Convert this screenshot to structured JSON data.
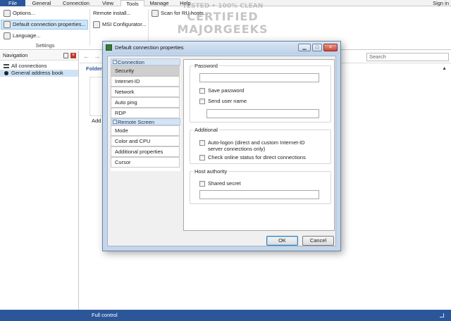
{
  "tabs": [
    "File",
    "General",
    "Connection",
    "View",
    "Tools",
    "Manage",
    "Help"
  ],
  "signin": "Sign in",
  "ribbon": {
    "options": "Options...",
    "default_conn": "Default connection properties...",
    "language": "Language...",
    "remote_install": "Remote install...",
    "msi_config": "MSI Configurator...",
    "scan": "Scan for RU hosts...",
    "group_settings": "Settings"
  },
  "watermark": {
    "line1": "TESTED • 100% CLEAN",
    "line2": "CERTIFIED",
    "line3": "MAJORGEEKS"
  },
  "navigation": {
    "title": "Navigation",
    "items": [
      "All connections",
      "General address book"
    ]
  },
  "main": {
    "search_placeholder": "Search",
    "folder_label": "Folder",
    "add_label": "Add"
  },
  "dialog": {
    "title": "Default connection properties",
    "categories": {
      "connection_header": "Connection",
      "connection_items": [
        "Security",
        "Internet-ID",
        "Network",
        "Auto ping",
        "RDP"
      ],
      "remote_header": "Remote Screen",
      "remote_items": [
        "Mode",
        "Color and CPU",
        "Additional properties",
        "Cursor"
      ]
    },
    "password_group": "Password",
    "save_password": "Save password",
    "send_user_name": "Send user name",
    "additional_group": "Additional",
    "auto_logon": "Auto-logon (direct and custom Internet-ID server connections only)",
    "check_online": "Check online status for direct connections",
    "host_authority_group": "Host authority",
    "shared_secret": "Shared secret",
    "ok": "OK",
    "cancel": "Cancel"
  },
  "status": {
    "text": "Full control"
  }
}
